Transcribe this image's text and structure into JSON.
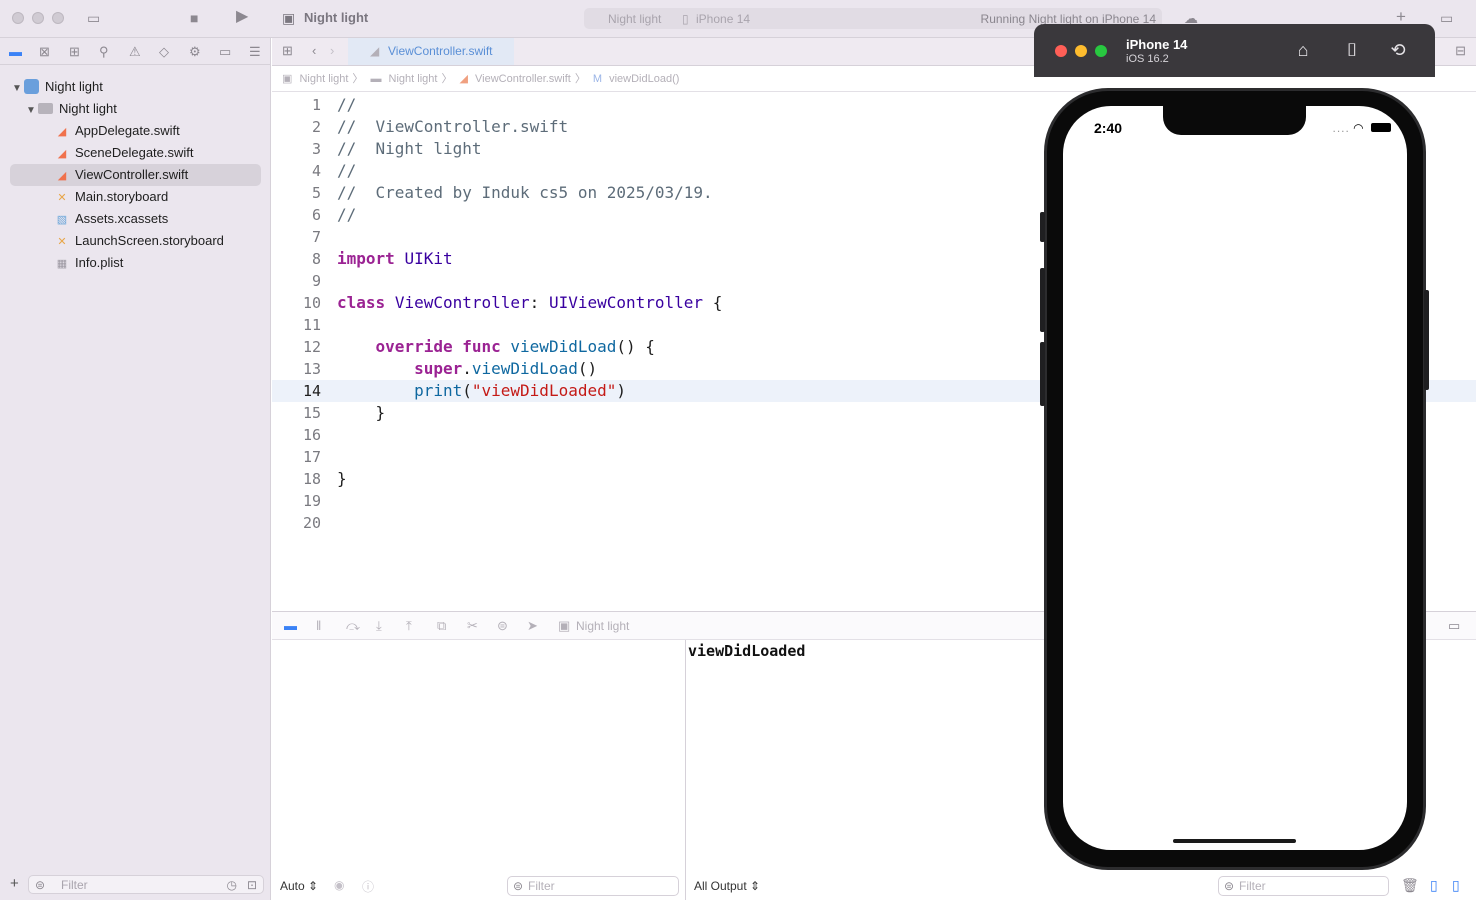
{
  "toolbar": {
    "project_title": "Night light",
    "scheme": "Night light",
    "device": "iPhone 14",
    "status": "Running Night light on iPhone 14"
  },
  "navigator": {
    "items": [
      {
        "label": "Night light",
        "kind": "project"
      },
      {
        "label": "Night light",
        "kind": "folder"
      },
      {
        "label": "AppDelegate.swift",
        "kind": "swift"
      },
      {
        "label": "SceneDelegate.swift",
        "kind": "swift"
      },
      {
        "label": "ViewController.swift",
        "kind": "swift",
        "selected": true
      },
      {
        "label": "Main.storyboard",
        "kind": "storyboard"
      },
      {
        "label": "Assets.xcassets",
        "kind": "assets"
      },
      {
        "label": "LaunchScreen.storyboard",
        "kind": "storyboard"
      },
      {
        "label": "Info.plist",
        "kind": "plist"
      }
    ],
    "filter_placeholder": "Filter"
  },
  "editor": {
    "tab_label": "ViewController.swift",
    "breadcrumb": [
      "Night light",
      "Night light",
      "ViewController.swift",
      "viewDidLoad()"
    ],
    "current_line": 14,
    "lines": [
      "//",
      "//  ViewController.swift",
      "//  Night light",
      "//",
      "//  Created by Induk cs5 on 2025/03/19.",
      "//",
      "",
      "import UIKit",
      "",
      "class ViewController: UIViewController {",
      "",
      "    override func viewDidLoad() {",
      "        super.viewDidLoad()",
      "        print(\"viewDidLoaded\")",
      "    }",
      "",
      "",
      "}",
      "",
      ""
    ]
  },
  "debug": {
    "process": "Night light",
    "console_output": "viewDidLoaded",
    "auto_label": "Auto ⇕",
    "filter_left": "Filter",
    "output_label": "All Output ⇕",
    "filter_right": "Filter"
  },
  "simulator": {
    "device_name": "iPhone 14",
    "os_version": "iOS 16.2",
    "time": "2:40"
  },
  "colors": {
    "accent": "#5a8fd6",
    "keyword": "#9b2393",
    "type": "#3900a0",
    "function": "#0f68a0",
    "string": "#c41a16",
    "comment": "#5d6c79"
  }
}
